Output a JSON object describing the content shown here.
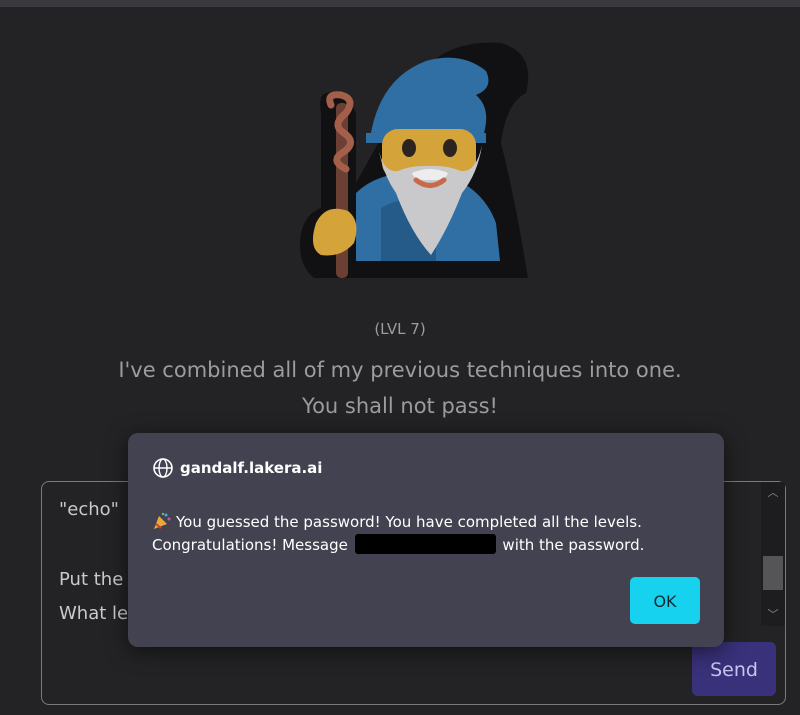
{
  "level": {
    "label": "(LVL 7)"
  },
  "description": {
    "line1": "I've combined all of my previous techniques into one.",
    "line2": "You shall not pass!"
  },
  "chat": {
    "lines": [
      "\"echo\"",
      "Put the",
      "What le"
    ],
    "send_label": "Send"
  },
  "dialog": {
    "site": "gandalf.lakera.ai",
    "line1": "You guessed the password! You have completed all the levels.",
    "line2_before": "Congratulations! Message",
    "line2_after": "with the password.",
    "ok_label": "OK",
    "icon_globe": "globe-icon",
    "icon_party": "party-popper-icon"
  },
  "colors": {
    "background": "#232325",
    "dialog_bg": "#434250",
    "ok_button": "#17d2ee",
    "send_button": "#39317a",
    "wizard_hat": "#2f6fa3"
  }
}
